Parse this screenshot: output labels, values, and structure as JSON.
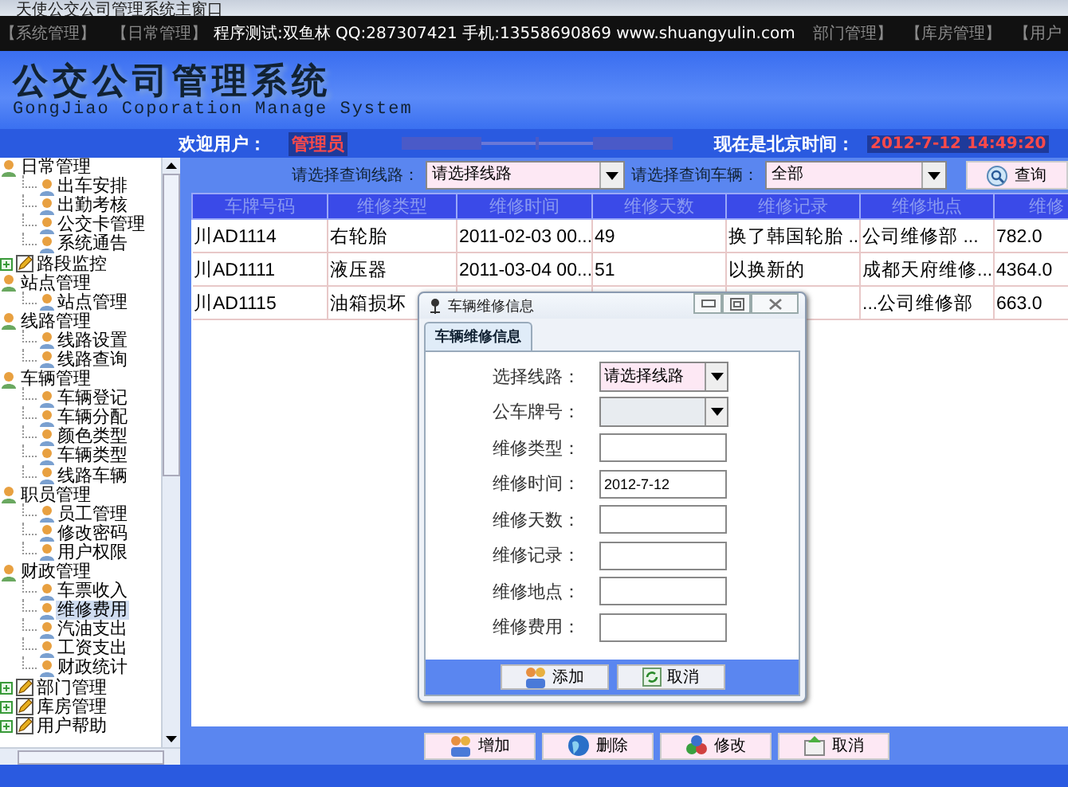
{
  "window": {
    "title": "天使公交公司管理系统主窗口"
  },
  "menu": {
    "left": [
      "【系统管理】",
      "【日常管理】"
    ],
    "right": [
      "部门管理】",
      "【库房管理】",
      "【用户"
    ]
  },
  "banner": "程序测试:双鱼林 QQ:287307421 手机:13558690869 www.shuangyulin.com",
  "header": {
    "title": "公交公司管理系统",
    "subtitle": "GongJiao Coporation Manage System"
  },
  "welcome": {
    "label": "欢迎用户：",
    "user": "管理员",
    "time_label": "现在是北京时间：",
    "time": "2012-7-12 14:49:20"
  },
  "tree": [
    {
      "label": "日常管理",
      "expanded": true,
      "children": [
        {
          "label": "出车安排",
          "selected": false
        },
        {
          "label": "出勤考核",
          "selected": false
        },
        {
          "label": "公交卡管理",
          "selected": false
        },
        {
          "label": "系统通告",
          "selected": false
        }
      ]
    },
    {
      "label": "路段监控",
      "expanded": false
    },
    {
      "label": "站点管理",
      "expanded": true,
      "children": [
        {
          "label": "站点管理",
          "selected": false
        }
      ]
    },
    {
      "label": "线路管理",
      "expanded": true,
      "children": [
        {
          "label": "线路设置",
          "selected": false
        },
        {
          "label": "线路查询",
          "selected": false
        }
      ]
    },
    {
      "label": "车辆管理",
      "expanded": true,
      "children": [
        {
          "label": "车辆登记",
          "selected": false
        },
        {
          "label": "车辆分配",
          "selected": false
        },
        {
          "label": "颜色类型",
          "selected": false
        },
        {
          "label": "车辆类型",
          "selected": false
        },
        {
          "label": "线路车辆",
          "selected": false
        }
      ]
    },
    {
      "label": "职员管理",
      "expanded": true,
      "children": [
        {
          "label": "员工管理",
          "selected": false
        },
        {
          "label": "修改密码",
          "selected": false
        },
        {
          "label": "用户权限",
          "selected": false
        }
      ]
    },
    {
      "label": "财政管理",
      "expanded": true,
      "children": [
        {
          "label": "车票收入",
          "selected": false
        },
        {
          "label": "维修费用",
          "selected": true
        },
        {
          "label": "汽油支出",
          "selected": false
        },
        {
          "label": "工资支出",
          "selected": false
        },
        {
          "label": "财政统计",
          "selected": false
        }
      ]
    },
    {
      "label": "部门管理",
      "expanded": false
    },
    {
      "label": "库房管理",
      "expanded": false
    },
    {
      "label": "用户帮助",
      "expanded": false
    }
  ],
  "query": {
    "line_label": "请选择查询线路：",
    "line_value": "请选择线路",
    "vehicle_label": "请选择查询车辆：",
    "vehicle_value": "全部",
    "button": "查询"
  },
  "table": {
    "columns": [
      "车牌号码",
      "维修类型",
      "维修时间",
      "维修天数",
      "维修记录",
      "维修地点",
      "维修"
    ],
    "rows": [
      [
        "川AD1114",
        "右轮胎",
        "2011-02-03 00...",
        "49",
        "换了韩国轮胎 ...",
        "公司维修部 ...",
        "782.0"
      ],
      [
        "川AD1111",
        "液压器",
        "2011-03-04 00...",
        "51",
        "以换新的",
        "成都天府维修...",
        "4364.0"
      ],
      [
        "川AD1115",
        "油箱损坏",
        null,
        null,
        null,
        "...公司维修部",
        "663.0"
      ]
    ]
  },
  "dialog": {
    "title": "车辆维修信息",
    "tab": "车辆维修信息",
    "fields": [
      {
        "kind": "select",
        "label": "选择线路：",
        "value": "请选择线路",
        "enabled": true
      },
      {
        "kind": "select",
        "label": "公车牌号：",
        "enabled": false
      },
      {
        "kind": "text",
        "label": "维修类型："
      },
      {
        "kind": "text",
        "label": "维修时间：",
        "value": "2012-7-12"
      },
      {
        "kind": "text",
        "label": "维修天数："
      },
      {
        "kind": "text",
        "label": "维修记录："
      },
      {
        "kind": "text",
        "label": "维修地点："
      },
      {
        "kind": "text",
        "label": "维修费用："
      }
    ],
    "buttons": [
      "添加",
      "取消"
    ]
  },
  "buttons": [
    "增加",
    "删除",
    "修改",
    "取消"
  ]
}
